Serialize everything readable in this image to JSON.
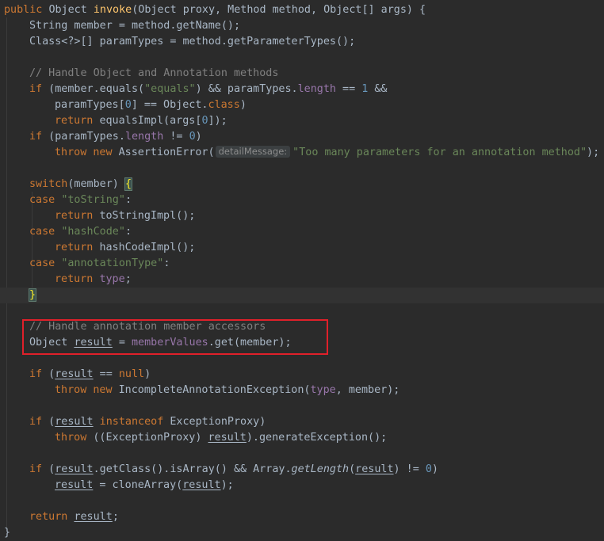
{
  "editor": {
    "sig": {
      "kw": "public ",
      "type": "Object ",
      "name": "invoke",
      "params": "(Object proxy, Method method, Object[] args) {"
    },
    "l2": {
      "a": "String member = method.getName();"
    },
    "l3": {
      "a": "Class<?>[] paramTypes = method.getParameterTypes();"
    },
    "l5": {
      "c": "// Handle Object and Annotation methods"
    },
    "l6": {
      "kw": "if",
      "a": " (member.equals(",
      "s": "\"equals\"",
      "b": ") && paramTypes.",
      "f": "length",
      "c": " == ",
      "n": "1",
      "d": " &&"
    },
    "l7": {
      "a": "paramTypes[",
      "n": "0",
      "b": "] == Object.",
      "kw": "class",
      "c": ")"
    },
    "l8": {
      "kw": "return ",
      "a": "equalsImpl(args[",
      "n": "0",
      "b": "]);"
    },
    "l9": {
      "kw": "if",
      "a": " (paramTypes.",
      "f": "length",
      "b": " != ",
      "n": "0",
      "c": ")"
    },
    "l10": {
      "kw1": "throw ",
      "kw2": "new ",
      "a": "AssertionError(",
      "hint": "detailMessage:",
      "s": "\"Too many parameters for an annotation method\"",
      "b": ");"
    },
    "l12": {
      "kw": "switch",
      "a": "(member) ",
      "br": "{"
    },
    "l13": {
      "kw": "case ",
      "s": "\"toString\"",
      "a": ":"
    },
    "l14": {
      "kw": "return ",
      "a": "toStringImpl();"
    },
    "l15": {
      "kw": "case ",
      "s": "\"hashCode\"",
      "a": ":"
    },
    "l16": {
      "kw": "return ",
      "a": "hashCodeImpl();"
    },
    "l17": {
      "kw": "case ",
      "s": "\"annotationType\"",
      "a": ":"
    },
    "l18": {
      "kw": "return ",
      "f": "type",
      "a": ";"
    },
    "l19": {
      "br": "}"
    },
    "l21": {
      "c": "// Handle annotation member accessors"
    },
    "l22": {
      "a": "Object ",
      "u": "result",
      "b": " = ",
      "f": "memberValues",
      "c": ".get(member);"
    },
    "l24": {
      "kw": "if",
      "a": " (",
      "u": "result",
      "b": " == ",
      "kw2": "null",
      "c": ")"
    },
    "l25": {
      "kw1": "throw ",
      "kw2": "new ",
      "a": "IncompleteAnnotationException(",
      "f": "type",
      "b": ", member);"
    },
    "l27": {
      "kw": "if",
      "a": " (",
      "u": "result",
      "kw2": " instanceof ",
      "b": "ExceptionProxy)"
    },
    "l28": {
      "kw": "throw ",
      "a": "((ExceptionProxy) ",
      "u": "result",
      "b": ").generateException();"
    },
    "l30": {
      "kw": "if",
      "a": " (",
      "u": "result",
      "b": ".getClass().isArray() && Array.",
      "it": "getLength",
      "c": "(",
      "u2": "result",
      "d": ") != ",
      "n": "0",
      "e": ")"
    },
    "l31": {
      "u": "result",
      "a": " = cloneArray(",
      "u2": "result",
      "b": ");"
    },
    "l33": {
      "kw": "return ",
      "u": "result",
      "a": ";"
    },
    "l34": {
      "br": "}"
    }
  },
  "colors": {
    "keyword": "#cc7832",
    "string": "#6a8759",
    "number": "#6897bb",
    "comment": "#808080",
    "function": "#ffc66d",
    "field": "#9876aa",
    "highlight_box": "#e0202a"
  }
}
